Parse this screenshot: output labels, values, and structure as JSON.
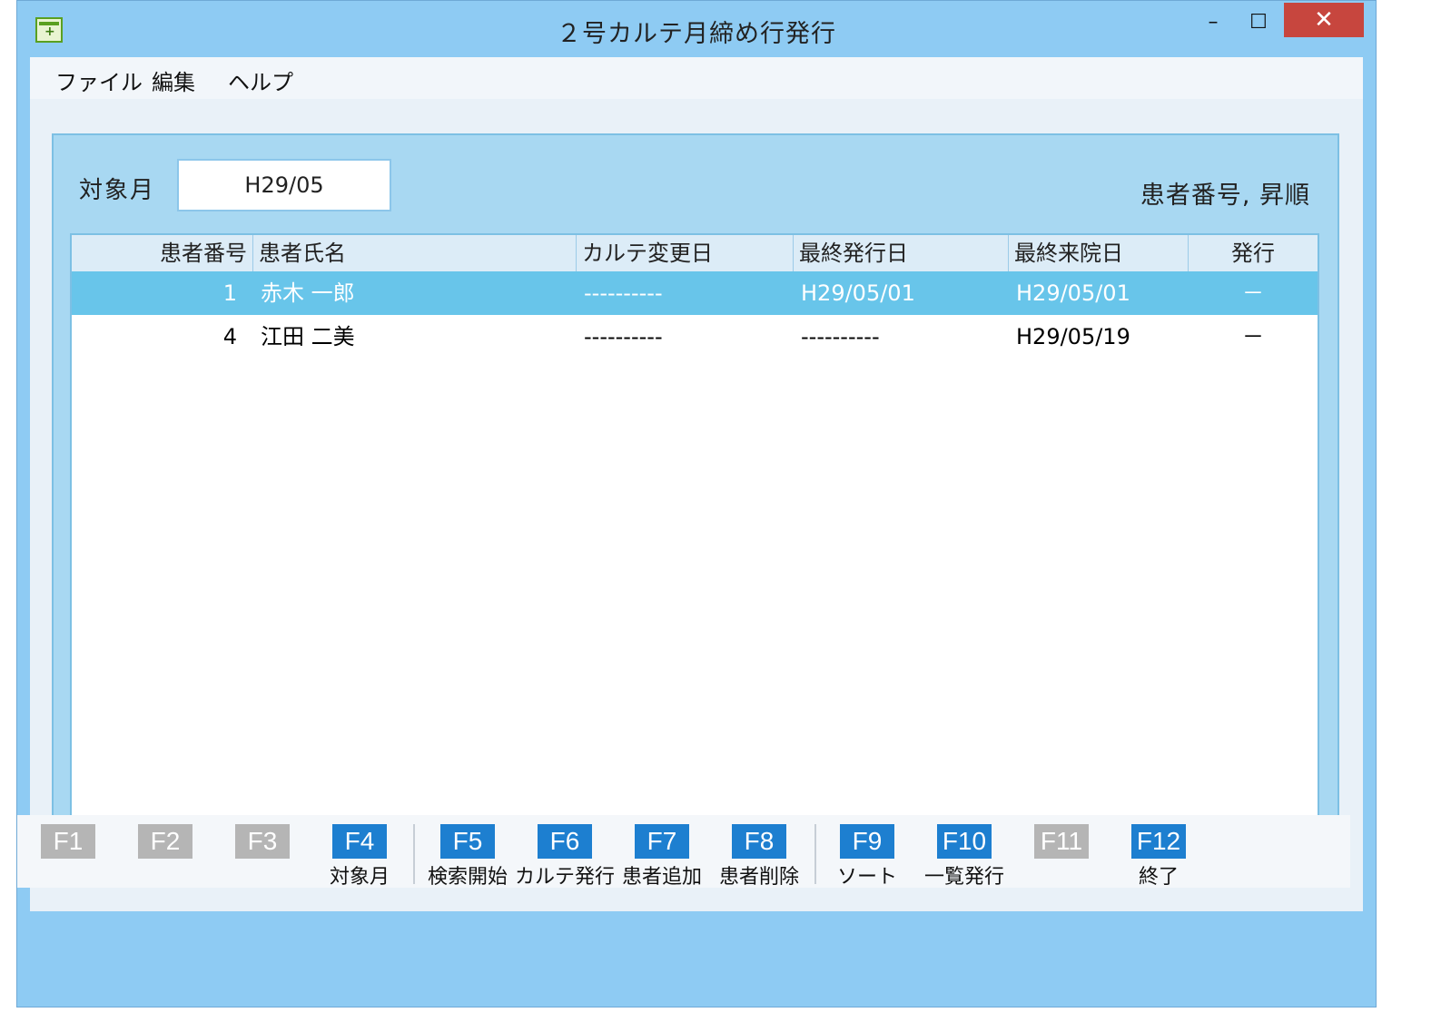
{
  "window": {
    "title": "２号カルテ月締め行発行",
    "controls": {
      "minimize": "–",
      "maximize": "☐",
      "close": "✕"
    }
  },
  "menu": [
    "ファイル",
    "編集",
    "ヘルプ"
  ],
  "filter": {
    "month_label": "対象月",
    "month_value": "H29/05"
  },
  "sort_status": "患者番号, 昇順",
  "table": {
    "columns": [
      "患者番号",
      "患者氏名",
      "カルテ変更日",
      "最終発行日",
      "最終来院日",
      "発行"
    ],
    "rows": [
      {
        "id": "1",
        "name": "赤木 一郎",
        "chart_changed": "----------",
        "last_issued": "H29/05/01",
        "last_visit": "H29/05/01",
        "issue": "－",
        "selected": true
      },
      {
        "id": "4",
        "name": "江田 二美",
        "chart_changed": "----------",
        "last_issued": "----------",
        "last_visit": "H29/05/19",
        "issue": "－",
        "selected": false
      }
    ]
  },
  "fkeys": [
    {
      "key": "F1",
      "label": "",
      "enabled": false
    },
    {
      "key": "F2",
      "label": "",
      "enabled": false
    },
    {
      "key": "F3",
      "label": "",
      "enabled": false
    },
    {
      "key": "F4",
      "label": "対象月",
      "enabled": true
    },
    {
      "key": "F5",
      "label": "検索開始",
      "enabled": true
    },
    {
      "key": "F6",
      "label": "カルテ発行",
      "enabled": true
    },
    {
      "key": "F7",
      "label": "患者追加",
      "enabled": true
    },
    {
      "key": "F8",
      "label": "患者削除",
      "enabled": true
    },
    {
      "key": "F9",
      "label": "ソート",
      "enabled": true
    },
    {
      "key": "F10",
      "label": "一覧発行",
      "enabled": true
    },
    {
      "key": "F11",
      "label": "",
      "enabled": false
    },
    {
      "key": "F12",
      "label": "終了",
      "enabled": true
    }
  ],
  "colors": {
    "titlebar": "#8ecbf3",
    "panel": "#a8d8f2",
    "selected_row": "#68c5ea",
    "fkey_on": "#1d7fd0",
    "fkey_off": "#b5b5b5",
    "close": "#c7463e"
  }
}
